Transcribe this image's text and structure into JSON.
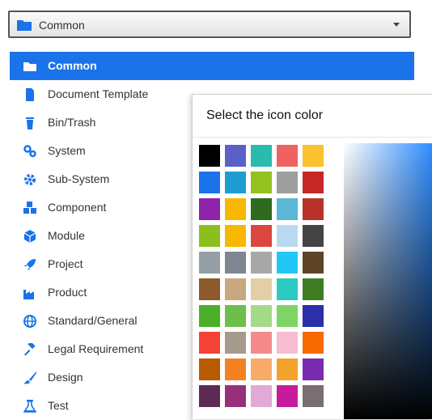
{
  "dropdown": {
    "selected": "Common",
    "icon": "folder-icon",
    "accent": "#1a73e8"
  },
  "list": {
    "items": [
      {
        "label": "Common",
        "icon": "folder-icon",
        "selected": true
      },
      {
        "label": "Document Template",
        "icon": "document-icon"
      },
      {
        "label": "Bin/Trash",
        "icon": "trash-icon"
      },
      {
        "label": "System",
        "icon": "cogs-icon"
      },
      {
        "label": "Sub-System",
        "icon": "cog-icon"
      },
      {
        "label": "Component",
        "icon": "cubes-icon"
      },
      {
        "label": "Module",
        "icon": "cube-icon"
      },
      {
        "label": "Project",
        "icon": "rocket-icon"
      },
      {
        "label": "Product",
        "icon": "industry-icon"
      },
      {
        "label": "Standard/General",
        "icon": "globe-icon"
      },
      {
        "label": "Legal Requirement",
        "icon": "gavel-icon"
      },
      {
        "label": "Design",
        "icon": "paint-brush-icon"
      },
      {
        "label": "Test",
        "icon": "flask-icon"
      }
    ]
  },
  "color_popover": {
    "title": "Select the icon color",
    "swatches": [
      [
        "#000000",
        "#5b5fc7",
        "#2bbbad",
        "#f06262",
        "#f9c22e"
      ],
      [
        "#1a73e8",
        "#1e9ed0",
        "#95c11f",
        "#9e9e9e",
        "#c62828"
      ],
      [
        "#8e24aa",
        "#f9b800",
        "#2e6b1f",
        "#5ab7d6",
        "#b7322a"
      ],
      [
        "#8bc01c",
        "#f9b800",
        "#d9473f",
        "#b9d9f0",
        "#444444"
      ],
      [
        "#95a0a5",
        "#7e8791",
        "#a7a7a7",
        "#22c7f5",
        "#5e4427"
      ],
      [
        "#8d5a2b",
        "#c8a87e",
        "#e2cfa8",
        "#2ccbc1",
        "#3f7d22"
      ],
      [
        "#4caf2a",
        "#6cc04a",
        "#a5d98a",
        "#7fd467",
        "#2b2fa8"
      ],
      [
        "#f44336",
        "#a59a8c",
        "#f48a8a",
        "#f7bccd",
        "#f66a00"
      ],
      [
        "#b95b00",
        "#f48222",
        "#f8ab68",
        "#f4a22c",
        "#7b2bb0"
      ],
      [
        "#5d2a54",
        "#96307a",
        "#e2a8d6",
        "#c61b9b",
        "#7a6e70"
      ]
    ]
  }
}
